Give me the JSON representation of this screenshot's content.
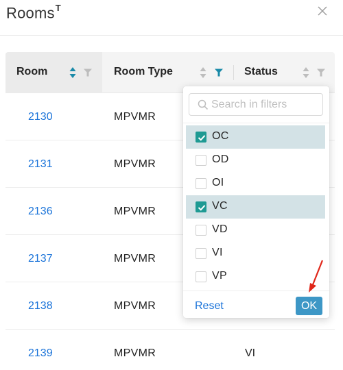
{
  "modal": {
    "title": "Rooms",
    "title_mark": "T"
  },
  "table": {
    "columns": [
      {
        "label": "Room"
      },
      {
        "label": "Room Type"
      },
      {
        "label": "Status"
      }
    ],
    "rows": [
      {
        "room": "2130",
        "type": "MPVMR",
        "status": ""
      },
      {
        "room": "2131",
        "type": "MPVMR",
        "status": ""
      },
      {
        "room": "2136",
        "type": "MPVMR",
        "status": ""
      },
      {
        "room": "2137",
        "type": "MPVMR",
        "status": ""
      },
      {
        "room": "2138",
        "type": "MPVMR",
        "status": ""
      },
      {
        "room": "2139",
        "type": "MPVMR",
        "status": "VI"
      }
    ]
  },
  "filter": {
    "search_placeholder": "Search in filters",
    "options": [
      {
        "label": "OC",
        "checked": true
      },
      {
        "label": "OD",
        "checked": false
      },
      {
        "label": "OI",
        "checked": false
      },
      {
        "label": "VC",
        "checked": true
      },
      {
        "label": "VD",
        "checked": false
      },
      {
        "label": "VI",
        "checked": false
      },
      {
        "label": "VP",
        "checked": false
      }
    ],
    "reset_label": "Reset",
    "ok_label": "OK"
  },
  "colors": {
    "link": "#1a73d9",
    "checkbox_on": "#1e9a93",
    "selected_row": "#d3e2e6",
    "ok_button": "#3d97c6",
    "active_filter": "#1a8aa8",
    "annotation_arrow": "#e0271a"
  },
  "icons": {
    "close": "close-icon",
    "sort": "sort-icon",
    "filter": "filter-icon",
    "search": "search-icon",
    "check": "check-icon",
    "annotation": "arrow-icon"
  }
}
